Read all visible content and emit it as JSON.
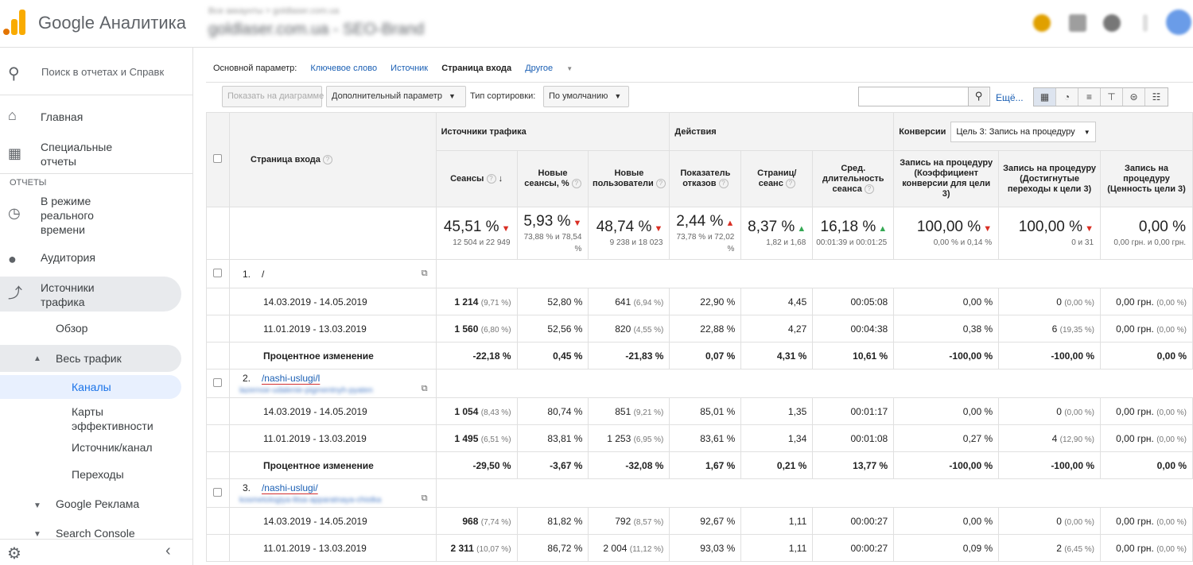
{
  "header": {
    "brand": "Google Аналитика",
    "account_path": "Все аккаунты > goldlaser.com.ua",
    "view_name": "goldlaser.com.ua - SEO-Brand"
  },
  "sidebar": {
    "search_placeholder": "Поиск в отчетах и Справк",
    "home": "Главная",
    "custom": "Специальные отчеты",
    "section": "ОТЧЕТЫ",
    "realtime": "В режиме реального времени",
    "audience": "Аудитория",
    "acquisition": "Источники трафика",
    "overview": "Обзор",
    "all_traffic": "Весь трафик",
    "channels": "Каналы",
    "treemaps": "Карты эффективности",
    "source_medium": "Источник/канал",
    "referrals": "Переходы",
    "google_ads": "Google Реклама",
    "search_console": "Search Console"
  },
  "toolbar": {
    "primary_label": "Основной параметр:",
    "dims": [
      "Ключевое слово",
      "Источник",
      "Страница входа",
      "Другое"
    ],
    "plot_btn": "Показать на диаграмме",
    "secondary_btn": "Дополнительный параметр",
    "sort_label": "Тип сортировки:",
    "sort_value": "По умолчанию",
    "more": "Ещё..."
  },
  "table": {
    "landing_col": "Страница входа",
    "groups": {
      "acq": "Источники трафика",
      "beh": "Действия",
      "conv": "Конверсии"
    },
    "conv_select": "Цель 3: Запись на процедуру",
    "metrics": [
      "Сеансы",
      "Новые сеансы, %",
      "Новые пользователи",
      "Показатель отказов",
      "Страниц/ сеанс",
      "Сред. длительность сеанса",
      "Запись на процедуру (Коэффициент конверсии для цели 3)",
      "Запись на процедуру (Достигнутые переходы к цели 3)",
      "Запись на процедуру (Ценность цели 3)"
    ],
    "totals": [
      {
        "v": "45,51 %",
        "dir": "dn",
        "s": "12 504 и 22 949"
      },
      {
        "v": "5,93 %",
        "dir": "dn",
        "s": "73,88 % и 78,54 %"
      },
      {
        "v": "48,74 %",
        "dir": "dn",
        "s": "9 238 и 18 023"
      },
      {
        "v": "2,44 %",
        "dir": "up",
        "s": "73,78 % и 72,02 %"
      },
      {
        "v": "8,37 %",
        "dir": "up2",
        "s": "1,82 и 1,68"
      },
      {
        "v": "16,18 %",
        "dir": "up2",
        "s": "00:01:39 и 00:01:25"
      },
      {
        "v": "100,00 %",
        "dir": "dn",
        "s": "0,00 % и 0,14 %"
      },
      {
        "v": "100,00 %",
        "dir": "dn",
        "s": "0 и 31"
      },
      {
        "v": "0,00 %",
        "dir": "",
        "s": "0,00 грн. и 0,00 грн."
      }
    ],
    "entries": [
      {
        "idx": "1.",
        "path": "/",
        "path_hidden": "",
        "rows": [
          {
            "p": "14.03.2019 - 14.05.2019",
            "c": [
              "1 214",
              "(9,71 %)",
              "52,80 %",
              "641",
              "(6,94 %)",
              "22,90 %",
              "4,45",
              "00:05:08",
              "0,00 %",
              "0",
              "(0,00 %)",
              "0,00 грн.",
              "(0,00 %)"
            ]
          },
          {
            "p": "11.01.2019 - 13.03.2019",
            "c": [
              "1 560",
              "(6,80 %)",
              "52,56 %",
              "820",
              "(4,55 %)",
              "22,88 %",
              "4,27",
              "00:04:38",
              "0,38 %",
              "6",
              "(19,35 %)",
              "0,00 грн.",
              "(0,00 %)"
            ]
          },
          {
            "p": "Процентное изменение",
            "c": [
              "-22,18 %",
              "",
              "0,45 %",
              "-21,83 %",
              "",
              "0,07 %",
              "4,31 %",
              "10,61 %",
              "-100,00 %",
              "-100,00 %",
              "",
              "0,00 %",
              ""
            ]
          }
        ]
      },
      {
        "idx": "2.",
        "path": "/nashi-uslugi/l",
        "path_hidden": "lazernoe-udalenie-pigmentnyh-pyaten",
        "rows": [
          {
            "p": "14.03.2019 - 14.05.2019",
            "c": [
              "1 054",
              "(8,43 %)",
              "80,74 %",
              "851",
              "(9,21 %)",
              "85,01 %",
              "1,35",
              "00:01:17",
              "0,00 %",
              "0",
              "(0,00 %)",
              "0,00 грн.",
              "(0,00 %)"
            ]
          },
          {
            "p": "11.01.2019 - 13.03.2019",
            "c": [
              "1 495",
              "(6,51 %)",
              "83,81 %",
              "1 253",
              "(6,95 %)",
              "83,61 %",
              "1,34",
              "00:01:08",
              "0,27 %",
              "4",
              "(12,90 %)",
              "0,00 грн.",
              "(0,00 %)"
            ]
          },
          {
            "p": "Процентное изменение",
            "c": [
              "-29,50 %",
              "",
              "-3,67 %",
              "-32,08 %",
              "",
              "1,67 %",
              "0,21 %",
              "13,77 %",
              "-100,00 %",
              "-100,00 %",
              "",
              "0,00 %",
              ""
            ]
          }
        ]
      },
      {
        "idx": "3.",
        "path": "/nashi-uslugi/",
        "path_hidden": "kosmetologiya-litsa-apparatnaya-chistka",
        "rows": [
          {
            "p": "14.03.2019 - 14.05.2019",
            "c": [
              "968",
              "(7,74 %)",
              "81,82 %",
              "792",
              "(8,57 %)",
              "92,67 %",
              "1,11",
              "00:00:27",
              "0,00 %",
              "0",
              "(0,00 %)",
              "0,00 грн.",
              "(0,00 %)"
            ]
          },
          {
            "p": "11.01.2019 - 13.03.2019",
            "c": [
              "2 311",
              "(10,07 %)",
              "86,72 %",
              "2 004",
              "(11,12 %)",
              "93,03 %",
              "1,11",
              "00:00:27",
              "0,09 %",
              "2",
              "(6,45 %)",
              "0,00 грн.",
              "(0,00 %)"
            ]
          }
        ]
      }
    ]
  }
}
